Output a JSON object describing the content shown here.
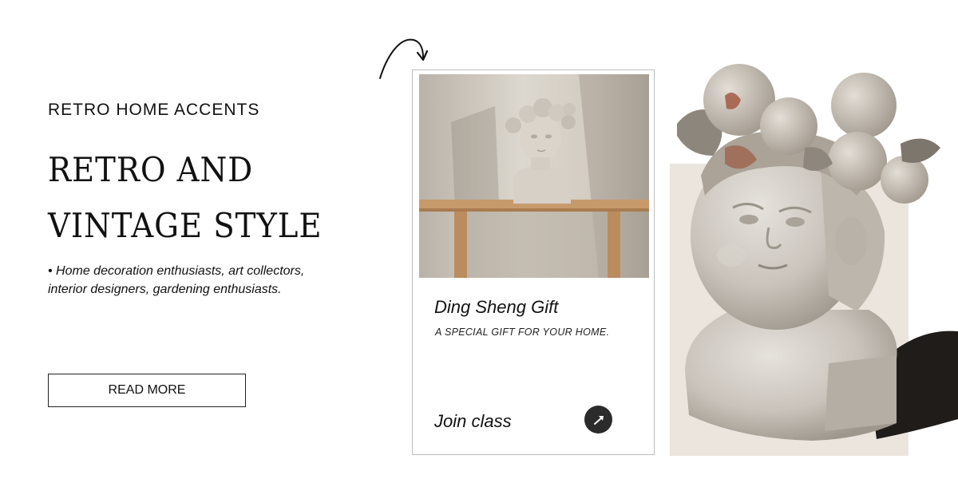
{
  "hero": {
    "eyebrow": "RETRO HOME ACCENTS",
    "headline_line1": "RETRO AND",
    "headline_line2": "VINTAGE STYLE",
    "bullet": "• Home decoration enthusiasts, art collectors, interior designers, gardening enthusiasts.",
    "cta_label": "READ MORE"
  },
  "card": {
    "title": "Ding Sheng Gift",
    "subtitle": "A SPECIAL GIFT FOR YOUR HOME.",
    "action_label": "Join class",
    "action_icon": "arrow-up-right-icon"
  },
  "colors": {
    "text": "#111111",
    "button_dark": "#2b2b2b",
    "panel_beige": "#ebe5de",
    "card_border": "#bdbdbd"
  }
}
